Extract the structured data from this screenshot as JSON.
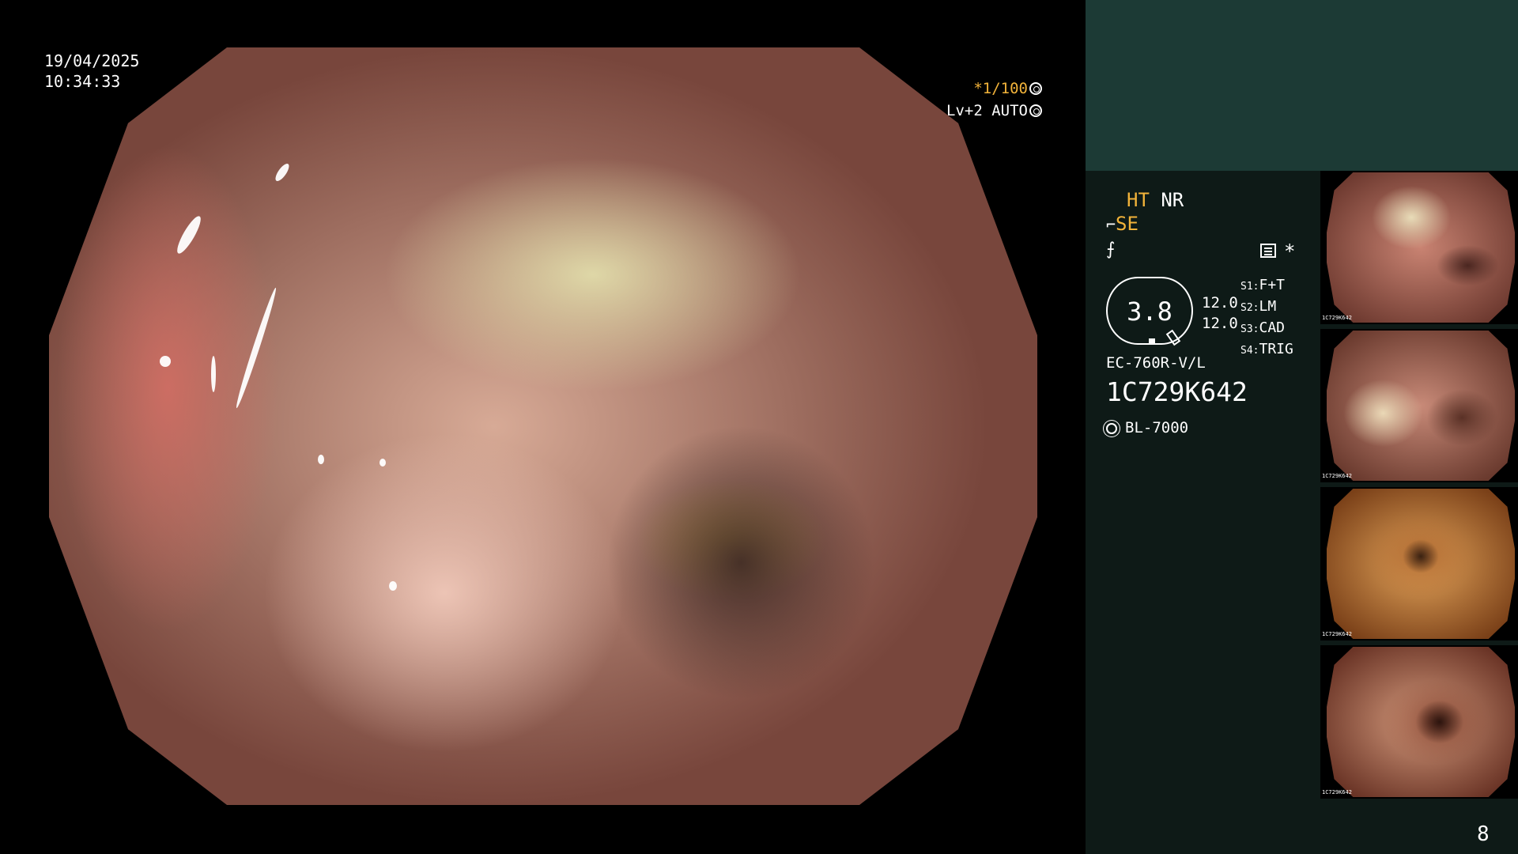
{
  "overlay": {
    "date": "19/04/2025",
    "time": "10:34:33",
    "shutter": "*1/100",
    "exposure": "Lv+2 AUTO"
  },
  "panel": {
    "mode_ht": "HT",
    "mode_nr": "NR",
    "mode_se": "SE",
    "star": "*",
    "zoom_value": "3.8",
    "level_1": "12.0",
    "level_2": "12.0",
    "settings": [
      {
        "key": "S1:",
        "value": "F+T"
      },
      {
        "key": "S2:",
        "value": "LM"
      },
      {
        "key": "S3:",
        "value": "CAD"
      },
      {
        "key": "S4:",
        "value": "TRIG"
      }
    ],
    "scope_model": "EC-760R-V/L",
    "scope_serial": "1C729K642",
    "light_source": "BL-7000"
  },
  "thumbnails": [
    {
      "serial": "1C729K642"
    },
    {
      "serial": "1C729K642"
    },
    {
      "serial": "1C729K642"
    },
    {
      "serial": "1C729K642"
    }
  ],
  "page_number": "8",
  "colors": {
    "panel_bg": "#0e1a17",
    "panel_top": "#1c3a35",
    "accent": "#f2b33a"
  }
}
